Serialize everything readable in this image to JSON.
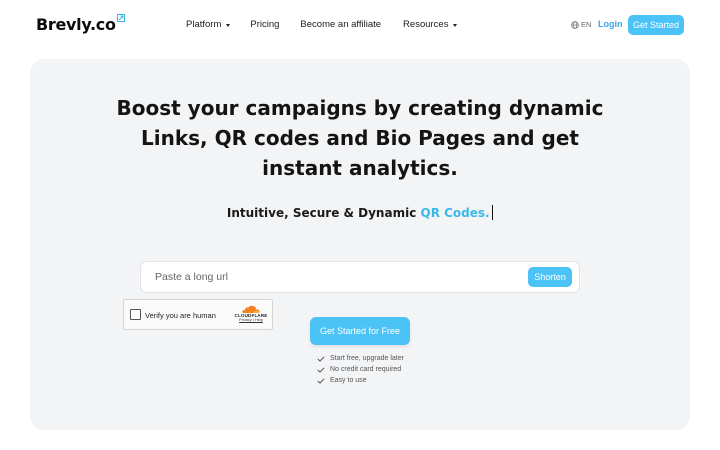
{
  "brand": {
    "name": "Brevly.co"
  },
  "nav": {
    "items": [
      {
        "label": "Platform",
        "has_dropdown": true
      },
      {
        "label": "Pricing",
        "has_dropdown": false
      },
      {
        "label": "Become an affiliate",
        "has_dropdown": false
      },
      {
        "label": "Resources",
        "has_dropdown": true
      }
    ],
    "language": "EN",
    "login": "Login",
    "cta": "Get Started"
  },
  "hero": {
    "headline_lines": [
      "Boost your campaigns by creating dynamic",
      "Links, QR codes and Bio Pages and get",
      "instant analytics."
    ],
    "subline_prefix": "Intuitive, Secure & Dynamic",
    "subline_accent": "QR Codes."
  },
  "shortener": {
    "placeholder": "Paste a long url",
    "button": "Shorten"
  },
  "captcha": {
    "label": "Verify you are human",
    "provider": "CLOUDFLARE",
    "links": "Privacy • Help"
  },
  "cta_main": "Get Started for Free",
  "features": [
    "Start free, upgrade later",
    "No credit card required",
    "Easy to use"
  ],
  "colors": {
    "accent": "#4cc3f7",
    "accent_text": "#3ab8e8",
    "hero_bg": "#f3f4f6"
  },
  "icons": {
    "language": "globe-icon",
    "dropdown": "chevron-down-icon",
    "feature": "check-icon",
    "captcha_brand": "cloudflare-cloud-icon"
  }
}
